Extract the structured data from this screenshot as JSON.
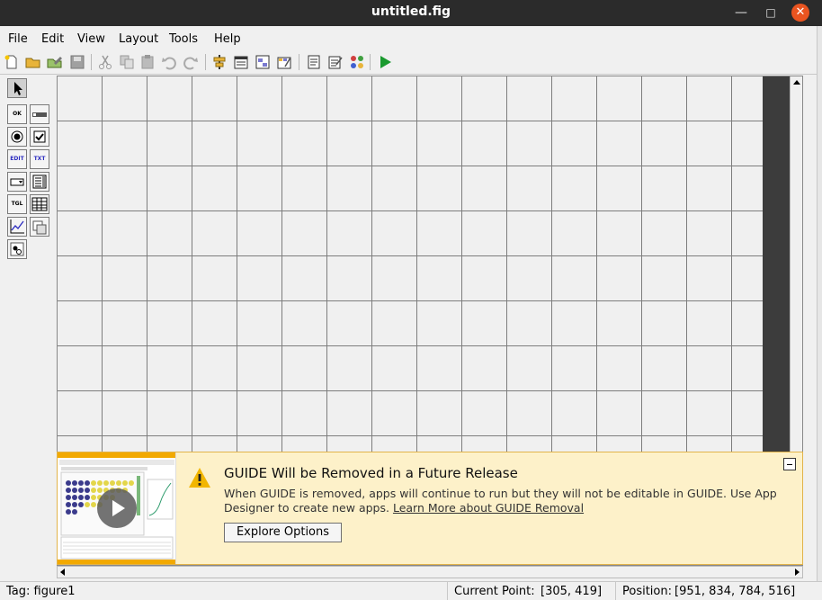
{
  "window": {
    "title": "untitled.fig"
  },
  "menu": [
    "File",
    "Edit",
    "View",
    "Layout",
    "Tools",
    "Help"
  ],
  "toolbar": {
    "icons": [
      "new-file-icon",
      "open-file-icon",
      "open-edit-icon",
      "save-icon",
      "cut-icon",
      "copy-icon",
      "paste-icon",
      "undo-icon",
      "redo-icon",
      "align-objects-icon",
      "menu-editor-icon",
      "tab-order-editor-icon",
      "toolbar-editor-icon",
      "editor-icon",
      "property-inspector-icon",
      "object-browser-icon",
      "run-figure-icon"
    ]
  },
  "palette": {
    "items": [
      {
        "name": "select-tool",
        "label": ""
      },
      {
        "name": "push-button-tool",
        "label": "OK"
      },
      {
        "name": "slider-tool",
        "label": ""
      },
      {
        "name": "radio-button-tool",
        "label": ""
      },
      {
        "name": "check-box-tool",
        "label": ""
      },
      {
        "name": "edit-text-tool",
        "label": "EDIT"
      },
      {
        "name": "static-text-tool",
        "label": "TXT"
      },
      {
        "name": "popup-menu-tool",
        "label": ""
      },
      {
        "name": "listbox-tool",
        "label": ""
      },
      {
        "name": "toggle-button-tool",
        "label": "TGL"
      },
      {
        "name": "table-tool",
        "label": ""
      },
      {
        "name": "axes-tool",
        "label": ""
      },
      {
        "name": "panel-tool",
        "label": ""
      },
      {
        "name": "button-group-tool",
        "label": ""
      }
    ]
  },
  "banner": {
    "title": "GUIDE Will be Removed in a Future Release",
    "body": "When GUIDE is removed, apps will continue to run but they will not be editable in GUIDE. Use App Designer to create new apps.",
    "link": "Learn More about GUIDE Removal",
    "button": "Explore Options"
  },
  "status": {
    "tag": "Tag: figure1",
    "current_point_label": "Current Point:",
    "current_point": "[305, 419]",
    "position_label": "Position:",
    "position": "[951, 834, 784, 516]"
  },
  "colors": {
    "titlebar": "#2b2b2b",
    "close": "#e95420",
    "banner_bg": "#fdf1c9",
    "banner_border": "#e1b34a",
    "run_green": "#1a9a2f"
  }
}
